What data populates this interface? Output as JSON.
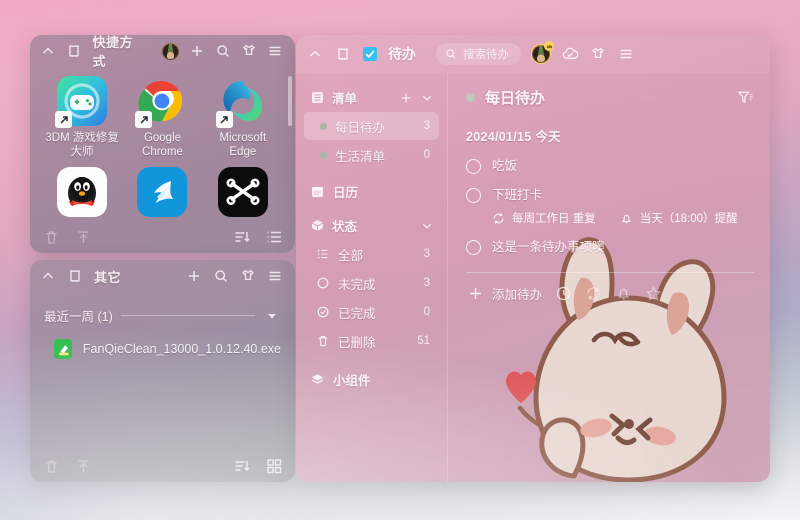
{
  "shortcuts_panel": {
    "title": "快捷方式",
    "toolbar": {
      "collapse_icon": "chevron-up-icon",
      "pin_icon": "pin-icon",
      "avatar_icon": "avatar",
      "add_icon": "plus-icon",
      "search_icon": "search-icon",
      "theme_icon": "shirt-icon",
      "menu_icon": "hamburger-icon"
    },
    "apps": [
      {
        "label": "3DM 游戏修复大师",
        "icon": "3dm-game-repair-icon"
      },
      {
        "label": "Google Chrome",
        "icon": "chrome-icon"
      },
      {
        "label": "Microsoft Edge",
        "icon": "edge-icon"
      },
      {
        "label": "",
        "icon": "qq-icon"
      },
      {
        "label": "",
        "icon": "dingtalk-icon"
      },
      {
        "label": "",
        "icon": "capcut-icon"
      }
    ],
    "footer": {
      "delete_icon": "trash-icon",
      "upload_icon": "upload-icon",
      "sort_icon": "sort-icon",
      "view_icon": "list-view-icon"
    }
  },
  "other_panel": {
    "title": "其它",
    "group_label": "最近一周 (1)",
    "files": [
      {
        "name": "FanQieClean_13000_1.0.12.40.exe",
        "icon": "cleaner-exe-icon"
      }
    ],
    "footer": {
      "delete_icon": "trash-icon",
      "upload_icon": "upload-icon",
      "sort_icon": "sort-icon",
      "view_icon": "grid-view-icon"
    }
  },
  "todo_panel": {
    "title": "待办",
    "title_icon": "checkbox-blue-icon",
    "search": {
      "placeholder": "搜索待办",
      "icon": "search-icon"
    },
    "topbar": {
      "collapse_icon": "chevron-up-icon",
      "pin_icon": "pin-icon",
      "cloud_icon": "cloud-check-icon",
      "theme_icon": "shirt-icon",
      "menu_icon": "hamburger-icon"
    },
    "sidebar": {
      "lists_section": {
        "label": "清单",
        "icon": "list-icon",
        "add_icon": "plus-icon",
        "collapse_icon": "chevron-down-icon"
      },
      "lists": [
        {
          "label": "每日待办",
          "count": "3",
          "selected": true
        },
        {
          "label": "生活清单",
          "count": "0",
          "selected": false
        }
      ],
      "calendar": {
        "label": "日历",
        "icon": "calendar-icon"
      },
      "status_section": {
        "label": "状态",
        "icon": "cube-icon",
        "collapse_icon": "chevron-down-icon"
      },
      "statuses": [
        {
          "label": "全部",
          "count": "3",
          "icon": "all-list-icon"
        },
        {
          "label": "未完成",
          "count": "3",
          "icon": "circle-icon"
        },
        {
          "label": "已完成",
          "count": "0",
          "icon": "check-circle-icon"
        },
        {
          "label": "已删除",
          "count": "51",
          "icon": "trash-icon"
        }
      ],
      "widgets": {
        "label": "小组件",
        "icon": "layers-icon"
      }
    },
    "main": {
      "list_title": "每日待办",
      "filter_icon": "filter-icon",
      "date_header": "2024/01/15  今天",
      "tasks": [
        {
          "text": "吃饭",
          "meta": []
        },
        {
          "text": "下班打卡",
          "meta": [
            {
              "icon": "repeat-icon",
              "text": "每周工作日  重复"
            },
            {
              "icon": "bell-icon",
              "text": "当天（18:00）提醒"
            }
          ]
        },
        {
          "text": "这是一条待办事项噢",
          "meta": []
        }
      ],
      "add_row": {
        "label": "添加待办",
        "plus_icon": "plus-icon",
        "icons": [
          "clock-icon",
          "repeat-icon",
          "bell-icon",
          "star-icon"
        ]
      },
      "mascot": "rabbit-illustration"
    }
  },
  "colors": {
    "panel_left": "#9c8a9e",
    "panel_todo": "#d9a3bc",
    "accent_blue": "#3bb8e8",
    "heart_red": "#e2504f",
    "rabbit_body": "#eedfd7",
    "rabbit_outline": "#86543f"
  }
}
